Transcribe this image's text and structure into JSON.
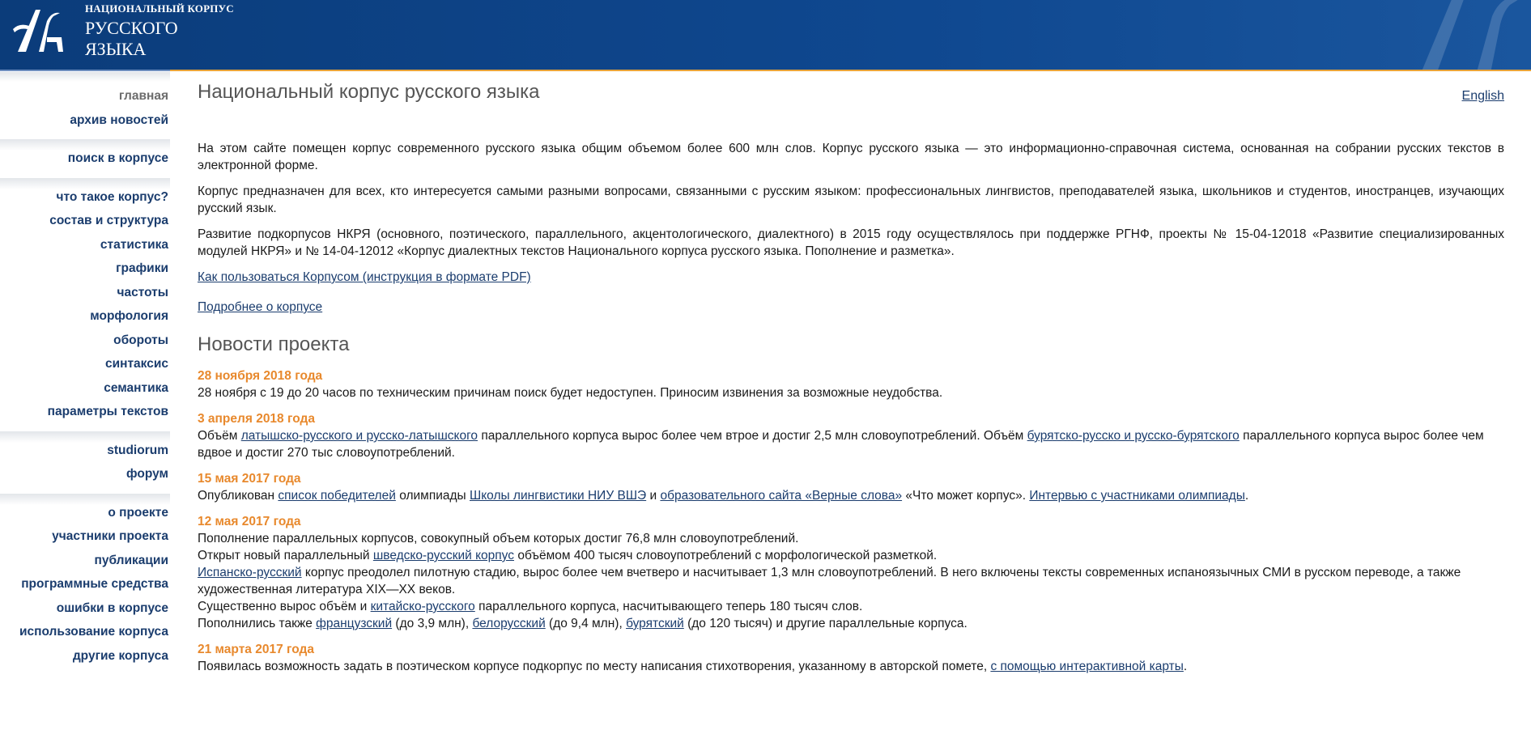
{
  "header": {
    "logo_line1": "НАЦИОНАЛЬНЫЙ КОРПУС",
    "logo_line2": "РУССКОГО",
    "logo_line3": "ЯЗЫКА",
    "colors": {
      "background": "#0f4890",
      "accent_stripe": "#e8a33a"
    }
  },
  "sidebar": {
    "group1": [
      {
        "label": "главная",
        "current": true
      },
      {
        "label": "архив новостей"
      }
    ],
    "group2": [
      {
        "label": "поиск в корпусе"
      }
    ],
    "group3": [
      {
        "label": "что такое корпус?"
      },
      {
        "label": "состав и структура"
      },
      {
        "label": "статистика"
      },
      {
        "label": "графики"
      },
      {
        "label": "частоты"
      },
      {
        "label": "морфология"
      },
      {
        "label": "обороты"
      },
      {
        "label": "синтаксис"
      },
      {
        "label": "семантика"
      },
      {
        "label": "параметры текстов"
      }
    ],
    "group4": [
      {
        "label": "studiorum"
      },
      {
        "label": "форум"
      }
    ],
    "group5": [
      {
        "label": "о проекте"
      },
      {
        "label": "участники проекта"
      },
      {
        "label": "публикации"
      },
      {
        "label": "программные средства"
      },
      {
        "label": "ошибки в корпусе"
      },
      {
        "label": "использование корпуса"
      },
      {
        "label": "другие корпуса"
      }
    ]
  },
  "main": {
    "title": "Национальный корпус русского языка",
    "english_link": "English",
    "intro_p1": "На этом сайте помещен корпус современного русского языка общим объемом более 600 млн слов. Корпус русского языка — это информационно-справочная система, основанная на собрании русских текстов в электронной форме.",
    "intro_p2": "Корпус предназначен для всех, кто интересуется самыми разными вопросами, связанными с русским языком: профессиональных лингвистов, преподавателей языка, школьников и студентов, иностранцев, изучающих русский язык.",
    "intro_p3": "Развитие подкорпусов НКРЯ (основного, поэтического, параллельного, акцентологического, диалектного) в 2015 году осуществлялось при поддержке РГНФ, проекты № 15-04-12018 «Развитие специализированных модулей НКРЯ» и № 14-04-12012 «Корпус диалектных текстов Национального корпуса русского языка. Пополнение и разметка».",
    "link_manual": "Как пользоваться Корпусом (инструкция в формате PDF)",
    "link_more": "Подробнее о корпусе",
    "news_title": "Новости проекта",
    "news": {
      "n1": {
        "date": "28 ноября 2018 года",
        "text": "28 ноября с 19 до 20 часов по техническим причинам поиск будет недоступен. Приносим извинения за возможные неудобства."
      },
      "n2": {
        "date": "3 апреля 2018 года",
        "t1": "Объём ",
        "l1": "латышско-русского и русско-латышского",
        "t2": " параллельного корпуса вырос более чем втрое и достиг 2,5 млн словоупотреблений. Объём ",
        "l2": "бурятско-русско и русско-бурятского",
        "t3": " параллельного корпуса вырос более чем вдвое и достиг 270 тыс словоупотреблений."
      },
      "n3": {
        "date": "15 мая 2017 года",
        "t1": "Опубликован ",
        "l1": "список победителей",
        "t2": " олимпиады ",
        "l2": "Школы лингвистики НИУ ВШЭ",
        "t3": " и ",
        "l3": "образовательного сайта «Верные слова»",
        "t4": " «Что может корпус». ",
        "l4": "Интервью с участниками олимпиады",
        "t5": "."
      },
      "n4": {
        "date": "12 мая 2017 года",
        "line1": "Пополнение параллельных корпусов, совокупный объем которых достиг 76,8 млн словоупотреблений.",
        "line2_t1": "Открыт новый параллельный ",
        "line2_l1": "шведско-русский корпус",
        "line2_t2": " объёмом 400 тысяч словоупотреблений с морфологической разметкой.",
        "line3_l1": "Испанско-русский",
        "line3_t1": " корпус преодолел пилотную стадию, вырос более чем вчетверо и насчитывает 1,3 млн словоупотреблений. В него включены тексты современных испаноязычных СМИ в русском переводе, а также художественная литература XIX—XX веков.",
        "line4_t1": "Существенно вырос объём и ",
        "line4_l1": "китайско-русского",
        "line4_t2": " параллельного корпуса, насчитывающего теперь 180 тысяч слов.",
        "line5_t1": "Пополнились также ",
        "line5_l1": "французский",
        "line5_t2": " (до 3,9 млн), ",
        "line5_l2": "белорусский",
        "line5_t3": " (до 9,4 млн), ",
        "line5_l3": "бурятский",
        "line5_t4": " (до 120 тысяч) и другие параллельные корпуса."
      },
      "n5": {
        "date": "21 марта 2017 года",
        "t1": "Появилась возможность задать в поэтическом корпусе подкорпус по месту написания стихотворения, указанному в авторской помете, ",
        "l1": "с помощью интерактивной карты",
        "t2": "."
      }
    }
  }
}
